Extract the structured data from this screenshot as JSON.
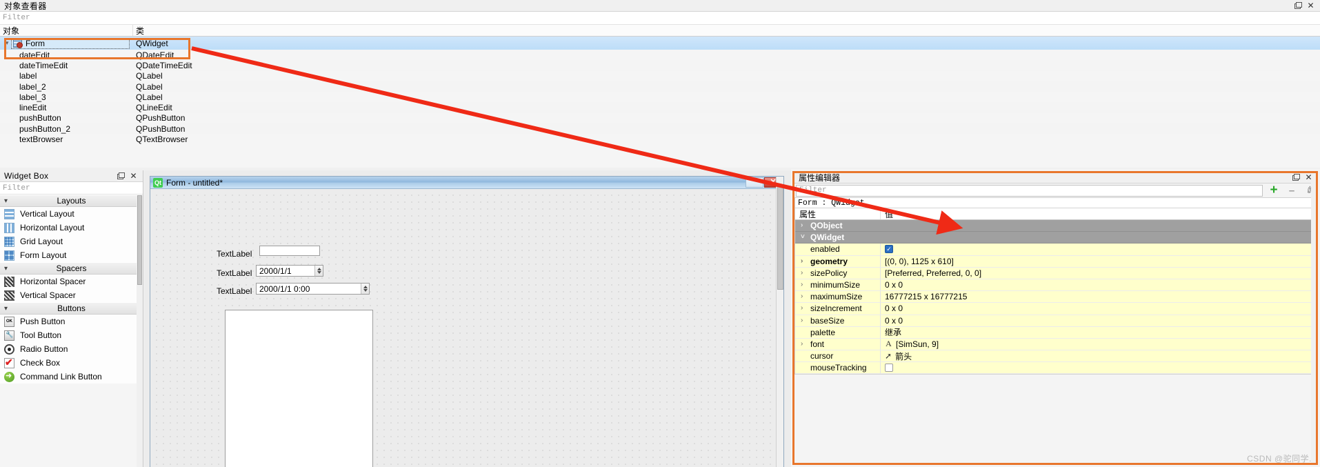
{
  "object_inspector": {
    "title": "对象查看器",
    "filter_placeholder": "Filter",
    "columns": [
      "对象",
      "类"
    ],
    "rows": [
      {
        "name": "Form",
        "class": "QWidget",
        "selected": true
      },
      {
        "name": "dateEdit",
        "class": "QDateEdit",
        "selected": false
      },
      {
        "name": "dateTimeEdit",
        "class": "QDateTimeEdit",
        "selected": false
      },
      {
        "name": "label",
        "class": "QLabel",
        "selected": false
      },
      {
        "name": "label_2",
        "class": "QLabel",
        "selected": false
      },
      {
        "name": "label_3",
        "class": "QLabel",
        "selected": false
      },
      {
        "name": "lineEdit",
        "class": "QLineEdit",
        "selected": false
      },
      {
        "name": "pushButton",
        "class": "QPushButton",
        "selected": false
      },
      {
        "name": "pushButton_2",
        "class": "QPushButton",
        "selected": false
      },
      {
        "name": "textBrowser",
        "class": "QTextBrowser",
        "selected": false
      }
    ]
  },
  "widget_box": {
    "title": "Widget Box",
    "filter_placeholder": "Filter",
    "sections": [
      {
        "label": "Layouts",
        "items": [
          {
            "label": "Vertical Layout",
            "icon": "vertical-layout-icon"
          },
          {
            "label": "Horizontal Layout",
            "icon": "horizontal-layout-icon"
          },
          {
            "label": "Grid Layout",
            "icon": "grid-layout-icon"
          },
          {
            "label": "Form Layout",
            "icon": "form-layout-icon"
          }
        ]
      },
      {
        "label": "Spacers",
        "items": [
          {
            "label": "Horizontal Spacer",
            "icon": "horizontal-spacer-icon"
          },
          {
            "label": "Vertical Spacer",
            "icon": "vertical-spacer-icon"
          }
        ]
      },
      {
        "label": "Buttons",
        "items": [
          {
            "label": "Push Button",
            "icon": "push-button-icon"
          },
          {
            "label": "Tool Button",
            "icon": "tool-button-icon"
          },
          {
            "label": "Radio Button",
            "icon": "radio-button-icon"
          },
          {
            "label": "Check Box",
            "icon": "check-box-icon"
          },
          {
            "label": "Command Link Button",
            "icon": "command-link-button-icon"
          }
        ]
      }
    ]
  },
  "designer": {
    "window_title": "Form - untitled*",
    "logo_text": "Qt",
    "close_label": "✕",
    "widgets": {
      "label_1": "TextLabel",
      "label_2": "TextLabel",
      "label_3": "TextLabel",
      "line_edit_value": "",
      "date_edit_value": "2000/1/1",
      "datetime_edit_value": "2000/1/1 0:00"
    }
  },
  "property_editor": {
    "title": "属性编辑器",
    "filter_placeholder": "Filter",
    "object_line": "Form : QWidget",
    "columns": [
      "属性",
      "值"
    ],
    "tools": {
      "add": "+",
      "remove": "–",
      "configure": "✐"
    },
    "rows": [
      {
        "name": "QObject",
        "value": "",
        "type": "group",
        "expander": "›",
        "bold": true
      },
      {
        "name": "QWidget",
        "value": "",
        "type": "group",
        "expander": "˅",
        "bold": true
      },
      {
        "name": "enabled",
        "value": "",
        "type": "checkbox-on",
        "expander": "",
        "bold": false
      },
      {
        "name": "geometry",
        "value": "[(0, 0), 1125 x 610]",
        "type": "text",
        "expander": "›",
        "bold": true
      },
      {
        "name": "sizePolicy",
        "value": "[Preferred, Preferred, 0, 0]",
        "type": "text",
        "expander": "›",
        "bold": false
      },
      {
        "name": "minimumSize",
        "value": "0 x 0",
        "type": "text",
        "expander": "›",
        "bold": false
      },
      {
        "name": "maximumSize",
        "value": "16777215 x 16777215",
        "type": "text",
        "expander": "›",
        "bold": false
      },
      {
        "name": "sizeIncrement",
        "value": "0 x 0",
        "type": "text",
        "expander": "›",
        "bold": false
      },
      {
        "name": "baseSize",
        "value": "0 x 0",
        "type": "text",
        "expander": "›",
        "bold": false
      },
      {
        "name": "palette",
        "value": "继承",
        "type": "text",
        "expander": "",
        "bold": false
      },
      {
        "name": "font",
        "value": "[SimSun, 9]",
        "type": "font",
        "expander": "›",
        "bold": false
      },
      {
        "name": "cursor",
        "value": "箭头",
        "type": "cursor",
        "expander": "",
        "bold": false
      },
      {
        "name": "mouseTracking",
        "value": "",
        "type": "checkbox-off",
        "expander": "",
        "bold": false
      }
    ]
  },
  "watermark": "CSDN @驼同学.",
  "colors": {
    "highlight": "#e8762c",
    "arrow": "#ef2a16",
    "selection": "#bdddf8",
    "property_row": "#ffffcc"
  }
}
